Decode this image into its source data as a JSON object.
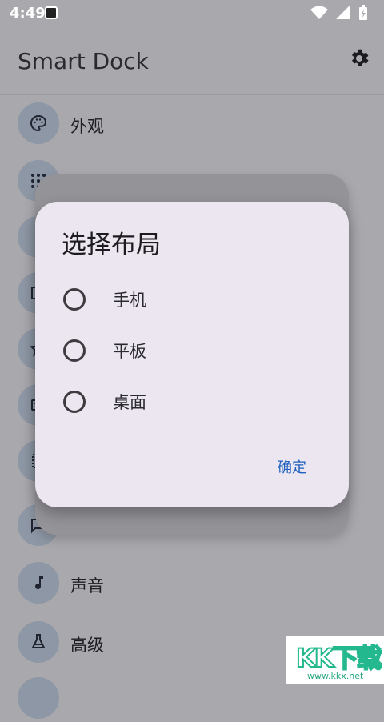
{
  "status": {
    "time": "4:49"
  },
  "header": {
    "title": "Smart Dock"
  },
  "menu": {
    "items": [
      {
        "label": "外观",
        "icon": "palette-icon"
      },
      {
        "label": "",
        "icon": "apps-grid-icon"
      },
      {
        "label": "",
        "icon": "more-dots-icon"
      },
      {
        "label": "",
        "icon": "window-icon"
      },
      {
        "label": "",
        "icon": "star-icon"
      },
      {
        "label": "",
        "icon": "keyboard-icon"
      },
      {
        "label": "",
        "icon": "widgets-icon"
      },
      {
        "label": "",
        "icon": "chat-icon"
      },
      {
        "label": "声音",
        "icon": "music-note-icon"
      },
      {
        "label": "高级",
        "icon": "flask-icon"
      }
    ]
  },
  "dialog": {
    "title": "选择布局",
    "options": [
      {
        "label": "手机"
      },
      {
        "label": "平板"
      },
      {
        "label": "桌面"
      }
    ],
    "confirm": "确定"
  },
  "watermark": {
    "logo": "KK下载",
    "url": "www.kkx.net"
  }
}
